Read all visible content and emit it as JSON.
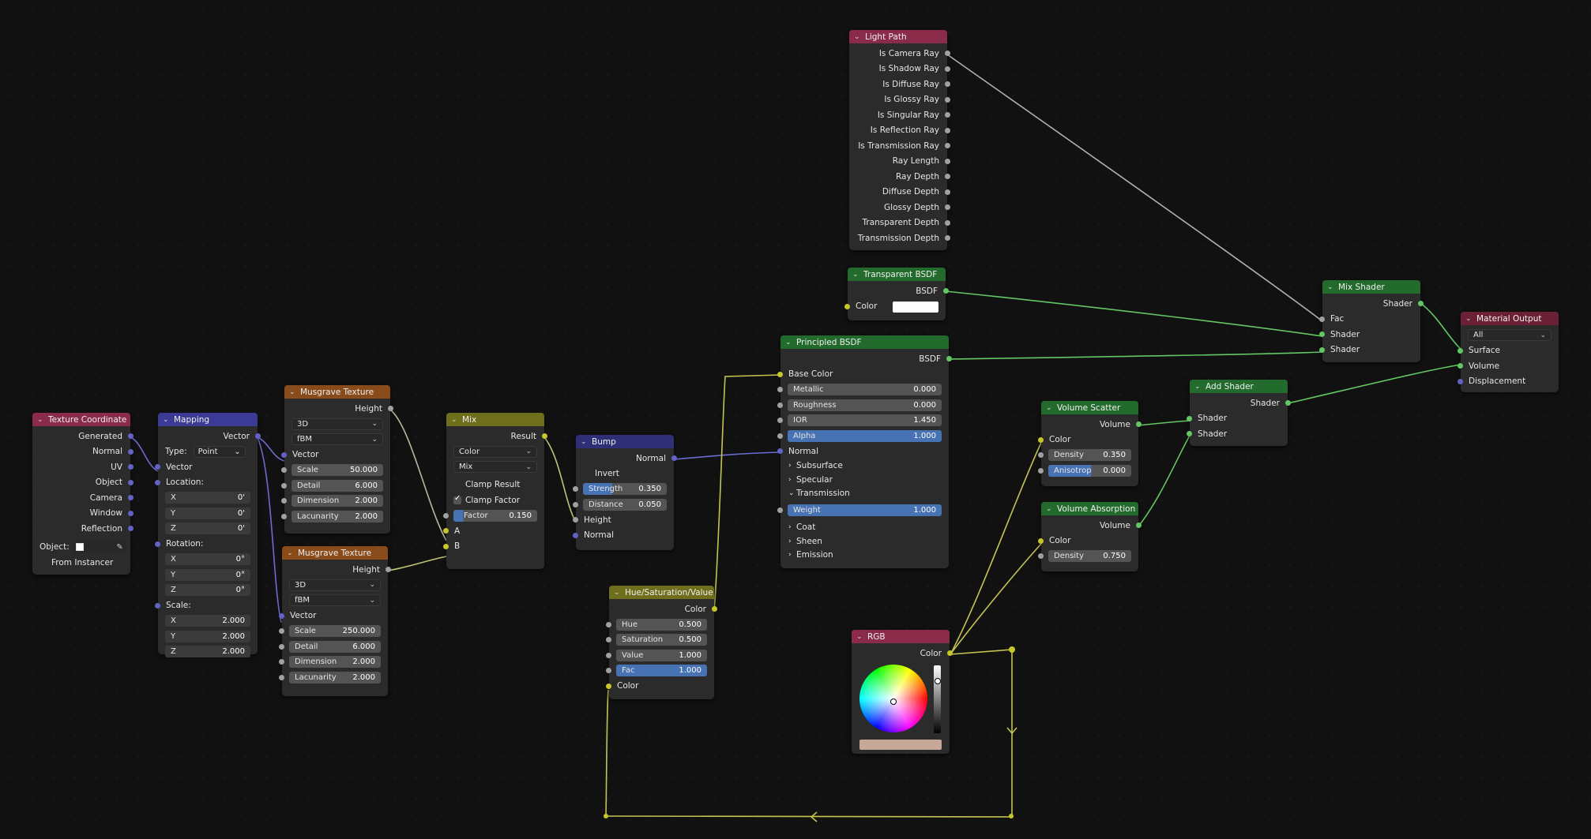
{
  "texture_coordinate": {
    "title": "Texture Coordinate",
    "outputs": [
      "Generated",
      "Normal",
      "UV",
      "Object",
      "Camera",
      "Window",
      "Reflection"
    ],
    "object_label": "Object:",
    "from_instancer": "From Instancer"
  },
  "mapping": {
    "title": "Mapping",
    "output": "Vector",
    "type_label": "Type:",
    "type_value": "Point",
    "vector_label": "Vector",
    "location_label": "Location:",
    "location": [
      {
        "axis": "X",
        "value": "0'"
      },
      {
        "axis": "Y",
        "value": "0'"
      },
      {
        "axis": "Z",
        "value": "0'"
      }
    ],
    "rotation_label": "Rotation:",
    "rotation": [
      {
        "axis": "X",
        "value": "0°"
      },
      {
        "axis": "Y",
        "value": "0°"
      },
      {
        "axis": "Z",
        "value": "0°"
      }
    ],
    "scale_label": "Scale:",
    "scale": [
      {
        "axis": "X",
        "value": "2.000"
      },
      {
        "axis": "Y",
        "value": "2.000"
      },
      {
        "axis": "Z",
        "value": "2.000"
      }
    ]
  },
  "musgrave1": {
    "title": "Musgrave Texture",
    "output": "Height",
    "dimensions": "3D",
    "type": "fBM",
    "vector_label": "Vector",
    "scale_label": "Scale",
    "scale": "50.000",
    "detail_label": "Detail",
    "detail": "6.000",
    "dimension_label": "Dimension",
    "dimension": "2.000",
    "lacunarity_label": "Lacunarity",
    "lacunarity": "2.000"
  },
  "musgrave2": {
    "title": "Musgrave Texture",
    "output": "Height",
    "dimensions": "3D",
    "type": "fBM",
    "vector_label": "Vector",
    "scale_label": "Scale",
    "scale": "250.000",
    "detail_label": "Detail",
    "detail": "6.000",
    "dimension_label": "Dimension",
    "dimension": "2.000",
    "lacunarity_label": "Lacunarity",
    "lacunarity": "2.000"
  },
  "mix": {
    "title": "Mix",
    "output": "Result",
    "data_type": "Color",
    "blend": "Mix",
    "clamp_result": "Clamp Result",
    "clamp_factor": "Clamp Factor",
    "factor_label": "Factor",
    "factor": "0.150",
    "input_a": "A",
    "input_b": "B"
  },
  "bump": {
    "title": "Bump",
    "output": "Normal",
    "invert": "Invert",
    "strength_label": "Strength",
    "strength": "0.350",
    "distance_label": "Distance",
    "distance": "0.050",
    "height_label": "Height",
    "normal_label": "Normal"
  },
  "hsv": {
    "title": "Hue/Saturation/Value",
    "output": "Color",
    "hue_label": "Hue",
    "hue": "0.500",
    "saturation_label": "Saturation",
    "saturation": "0.500",
    "value_label": "Value",
    "value": "1.000",
    "fac_label": "Fac",
    "fac": "1.000",
    "color_label": "Color"
  },
  "light_path": {
    "title": "Light Path",
    "outputs": [
      "Is Camera Ray",
      "Is Shadow Ray",
      "Is Diffuse Ray",
      "Is Glossy Ray",
      "Is Singular Ray",
      "Is Reflection Ray",
      "Is Transmission Ray",
      "Ray Length",
      "Ray Depth",
      "Diffuse Depth",
      "Glossy Depth",
      "Transparent Depth",
      "Transmission Depth"
    ]
  },
  "transparent_bsdf": {
    "title": "Transparent BSDF",
    "output": "BSDF",
    "color_label": "Color",
    "color": "#ffffff"
  },
  "principled": {
    "title": "Principled BSDF",
    "output": "BSDF",
    "base_color": "Base Color",
    "metallic_label": "Metallic",
    "metallic": "0.000",
    "roughness_label": "Roughness",
    "roughness": "0.000",
    "ior_label": "IOR",
    "ior": "1.450",
    "alpha_label": "Alpha",
    "alpha": "1.000",
    "normal_label": "Normal",
    "subsurface": "Subsurface",
    "specular": "Specular",
    "transmission": "Transmission",
    "weight_label": "Weight",
    "weight": "1.000",
    "coat": "Coat",
    "sheen": "Sheen",
    "emission": "Emission"
  },
  "rgb": {
    "title": "RGB",
    "output": "Color",
    "swatch": "#c7a797"
  },
  "volume_scatter": {
    "title": "Volume Scatter",
    "output": "Volume",
    "color_label": "Color",
    "density_label": "Density",
    "density": "0.350",
    "anisotropy_label": "Anisotrop",
    "anisotropy": "0.000"
  },
  "volume_absorption": {
    "title": "Volume Absorption",
    "output": "Volume",
    "color_label": "Color",
    "density_label": "Density",
    "density": "0.750"
  },
  "add_shader": {
    "title": "Add Shader",
    "output": "Shader",
    "in1": "Shader",
    "in2": "Shader"
  },
  "mix_shader": {
    "title": "Mix Shader",
    "output": "Shader",
    "fac": "Fac",
    "in1": "Shader",
    "in2": "Shader"
  },
  "material_output": {
    "title": "Material Output",
    "target": "All",
    "surface": "Surface",
    "volume": "Volume",
    "displacement": "Displacement"
  },
  "colors": {
    "background": "#111111",
    "node_body": "#2b2b2b",
    "socket_gray": "#a1a1a1",
    "socket_yellow": "#c7c729",
    "socket_purple": "#6363c7",
    "socket_green": "#63c763",
    "field_blue": "#4772b3"
  }
}
